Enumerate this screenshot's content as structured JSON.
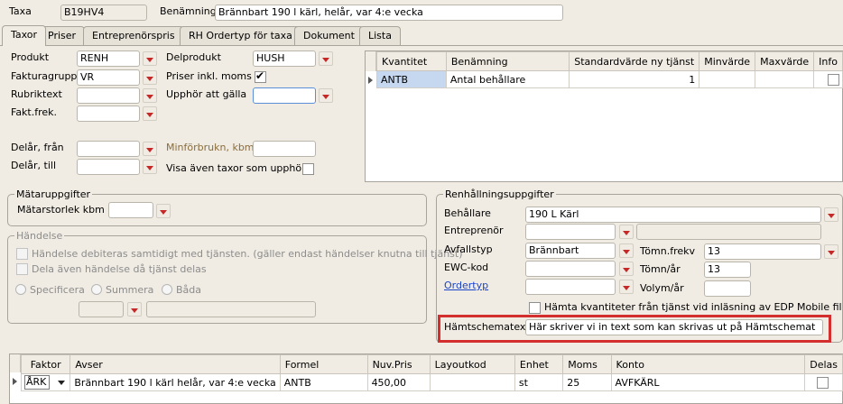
{
  "header": {
    "taxa_label": "Taxa",
    "taxa_value": "B19HV4",
    "benamning_label": "Benämning",
    "benamning_value": "Brännbart 190 l kärl, helår, var 4:e vecka"
  },
  "tabs": [
    {
      "label": "Taxor",
      "active": true
    },
    {
      "label": "Priser"
    },
    {
      "label": "Entreprenörspris"
    },
    {
      "label": "RH Ordertyp för taxa"
    },
    {
      "label": "Dokument"
    },
    {
      "label": "Lista"
    }
  ],
  "form": {
    "produkt_label": "Produkt",
    "produkt_value": "RENH",
    "fakturagrupp_label": "Fakturagrupp",
    "fakturagrupp_value": "VR",
    "rubriktext_label": "Rubriktext",
    "faktfrek_label": "Fakt.frek.",
    "delprodukt_label": "Delprodukt",
    "delprodukt_value": "HUSH",
    "priser_moms_label": "Priser inkl. moms",
    "priser_moms_checked": true,
    "upphor_label": "Upphör att gälla",
    "delar_fran_label": "Delår, från",
    "delar_till_label": "Delår, till",
    "minforbrukn_label": "Minförbrukn, kbm",
    "visa_label": "Visa även taxor som upphört"
  },
  "tjanst_table": {
    "columns": [
      "Kvantitet",
      "Benämning",
      "Standardvärde ny tjänst",
      "Minvärde",
      "Maxvärde",
      "Info"
    ],
    "rows": [
      {
        "kvantitet": "ANTB",
        "benamning": "Antal behållare",
        "standard": "1",
        "min": "",
        "max": "",
        "info": false
      }
    ]
  },
  "matar": {
    "title": "Mätaruppgifter",
    "storlek_label": "Mätarstorlek kbm"
  },
  "handelse": {
    "title": "Händelse",
    "debiteras_label": "Händelse debiteras samtidigt med tjänsten. (gäller endast händelser knutna till tjänst)",
    "dela_label": "Dela även händelse då tjänst delas",
    "radio_specificera": "Specificera",
    "radio_summera": "Summera",
    "radio_bada": "Båda"
  },
  "renh": {
    "title": "Renhållningsuppgifter",
    "behallare_label": "Behållare",
    "behallare_value": "190 L Kärl",
    "entreprenor_label": "Entreprenör",
    "avfallstyp_label": "Avfallstyp",
    "avfallstyp_value": "Brännbart",
    "ewc_label": "EWC-kod",
    "ordertyp_label": "Ordertyp",
    "tomnfrekv_label": "Tömn.frekv",
    "tomnfrekv_value": "13",
    "tomnar_label": "Tömn/år",
    "tomnar_value": "13",
    "volym_label": "Volym/år",
    "hamta_label": "Hämta kvantiteter från tjänst vid inläsning av EDP Mobile fil",
    "hamtschema_label": "Hämtschematext",
    "hamtschema_value": "Här skriver vi in text som kan skrivas ut på Hämtschemat"
  },
  "bottom_table": {
    "columns": [
      "Faktor",
      "Avser",
      "Formel",
      "Nuv.Pris",
      "Layoutkod",
      "Enhet",
      "Moms",
      "Konto",
      "Delas"
    ],
    "rows": [
      {
        "faktor": "ÅRK",
        "avser": "Brännbart 190 l kärl helår, var 4:e vecka",
        "formel": "ANTB",
        "pris": "450,00",
        "layoutkod": "",
        "enhet": "st",
        "moms": "25",
        "konto": "AVFKÄRL",
        "delas": false
      }
    ]
  },
  "colors": {
    "highlight": "#d32f2f",
    "background": "#f0ece3",
    "selected_cell": "#c6d8f0",
    "link": "#1a44c8"
  }
}
